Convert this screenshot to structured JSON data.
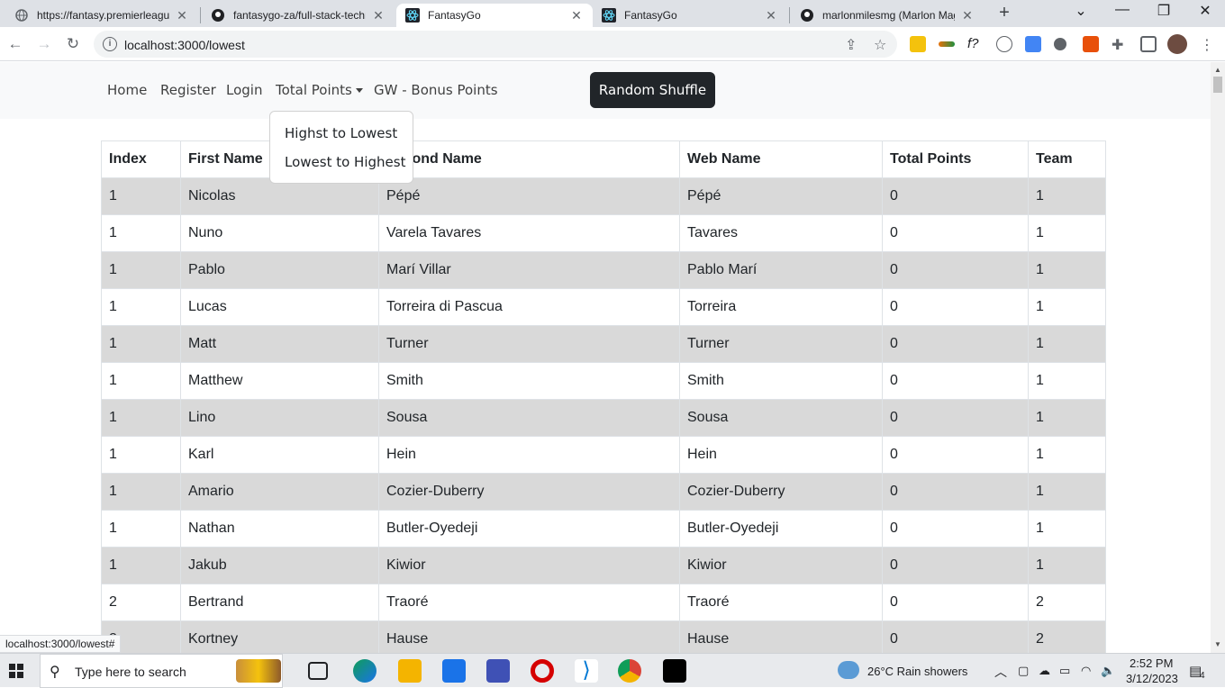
{
  "browser": {
    "tabs": [
      {
        "title": "https://fantasy.premierleague"
      },
      {
        "title": "fantasygo-za/full-stack-techn"
      },
      {
        "title": "FantasyGo"
      },
      {
        "title": "FantasyGo"
      },
      {
        "title": "marlonmilesmg (Marlon Mag"
      }
    ],
    "url": "localhost:3000/lowest",
    "status_url": "localhost:3000/lowest#"
  },
  "navbar": {
    "home": "Home",
    "register": "Register",
    "login": "Login",
    "total_points": "Total Points",
    "bonus": "GW - Bonus Points",
    "shuffle": "Random Shuffle"
  },
  "dropdown": {
    "items": [
      "Highst to Lowest",
      "Lowest to Highest"
    ]
  },
  "table": {
    "headers": [
      "Index",
      "First Name",
      "Second Name",
      "Web Name",
      "Total Points",
      "Team"
    ],
    "rows": [
      [
        "1",
        "Nicolas",
        "Pépé",
        "Pépé",
        "0",
        "1"
      ],
      [
        "1",
        "Nuno",
        "Varela Tavares",
        "Tavares",
        "0",
        "1"
      ],
      [
        "1",
        "Pablo",
        "Marí Villar",
        "Pablo Marí",
        "0",
        "1"
      ],
      [
        "1",
        "Lucas",
        "Torreira di Pascua",
        "Torreira",
        "0",
        "1"
      ],
      [
        "1",
        "Matt",
        "Turner",
        "Turner",
        "0",
        "1"
      ],
      [
        "1",
        "Matthew",
        "Smith",
        "Smith",
        "0",
        "1"
      ],
      [
        "1",
        "Lino",
        "Sousa",
        "Sousa",
        "0",
        "1"
      ],
      [
        "1",
        "Karl",
        "Hein",
        "Hein",
        "0",
        "1"
      ],
      [
        "1",
        "Amario",
        "Cozier-Duberry",
        "Cozier-Duberry",
        "0",
        "1"
      ],
      [
        "1",
        "Nathan",
        "Butler-Oyedeji",
        "Butler-Oyedeji",
        "0",
        "1"
      ],
      [
        "1",
        "Jakub",
        "Kiwior",
        "Kiwior",
        "0",
        "1"
      ],
      [
        "2",
        "Bertrand",
        "Traoré",
        "Traoré",
        "0",
        "2"
      ],
      [
        "2",
        "Kortney",
        "Hause",
        "Hause",
        "0",
        "2"
      ]
    ]
  },
  "taskbar": {
    "search_placeholder": "Type here to search",
    "weather": "26°C  Rain showers",
    "time": "2:52 PM",
    "date": "3/12/2023",
    "notifications": "4"
  }
}
